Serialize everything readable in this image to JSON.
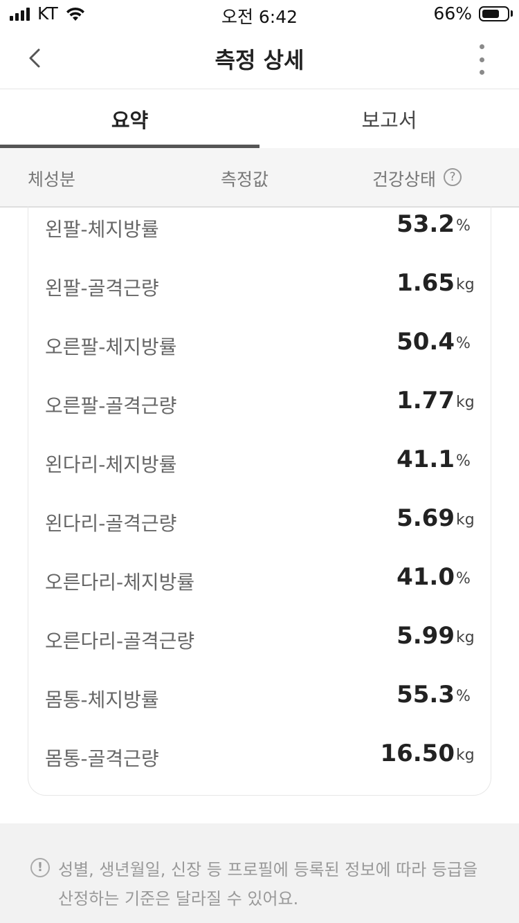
{
  "status": {
    "carrier": "KT",
    "time": "오전 6:42",
    "battery": "66%",
    "battery_level": 0.66
  },
  "header": {
    "title": "측정 상세",
    "back_icon": "chevron-left-icon",
    "menu_icon": "more-vertical-icon"
  },
  "tabs": [
    {
      "label": "요약",
      "active": true
    },
    {
      "label": "보고서",
      "active": false
    }
  ],
  "columns": {
    "c1": "체성분",
    "c2": "측정값",
    "c3": "건강상태",
    "help_icon": "question-icon"
  },
  "rows": [
    {
      "label": "왼팔-체지방률",
      "value": "53.2",
      "unit": "%"
    },
    {
      "label": "왼팔-골격근량",
      "value": "1.65",
      "unit": "kg"
    },
    {
      "label": "오른팔-체지방률",
      "value": "50.4",
      "unit": "%"
    },
    {
      "label": "오른팔-골격근량",
      "value": "1.77",
      "unit": "kg"
    },
    {
      "label": "왼다리-체지방률",
      "value": "41.1",
      "unit": "%"
    },
    {
      "label": "왼다리-골격근량",
      "value": "5.69",
      "unit": "kg"
    },
    {
      "label": "오른다리-체지방률",
      "value": "41.0",
      "unit": "%"
    },
    {
      "label": "오른다리-골격근량",
      "value": "5.99",
      "unit": "kg"
    },
    {
      "label": "몸통-체지방률",
      "value": "55.3",
      "unit": "%"
    },
    {
      "label": "몸통-골격근량",
      "value": "16.50",
      "unit": "kg"
    }
  ],
  "notice": {
    "icon": "info-icon",
    "text": "성별, 생년월일, 신장 등 프로필에 등록된 정보에 따라 등급을 산정하는 기준은 달라질 수 있어요."
  }
}
